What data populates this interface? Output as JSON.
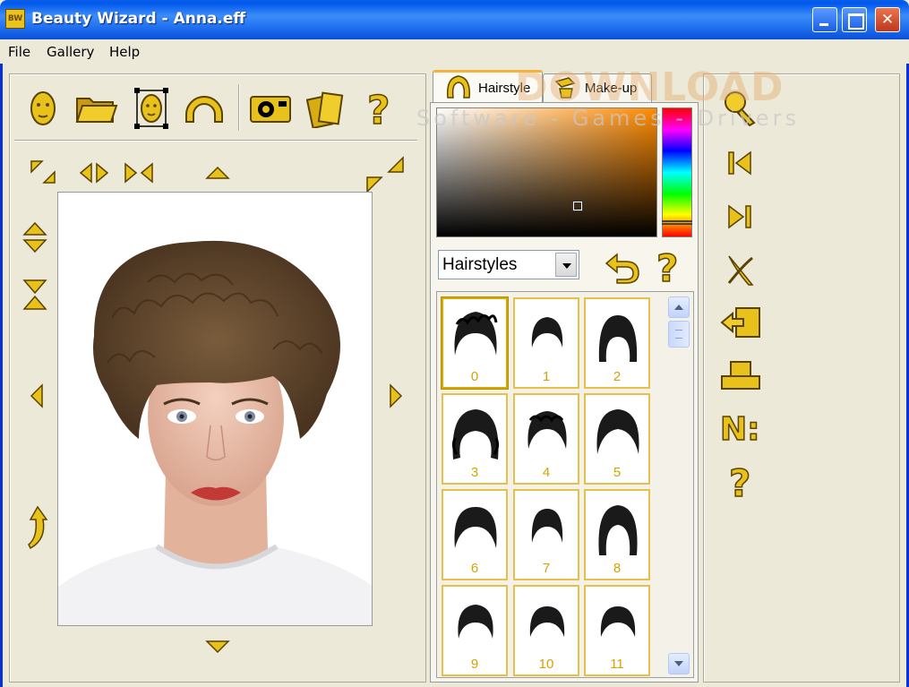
{
  "window": {
    "title": "Beauty Wizard - Anna.eff",
    "app_icon_text": "BW"
  },
  "menu": {
    "file": "File",
    "gallery": "Gallery",
    "help": "Help"
  },
  "toolbar": {
    "icons": [
      "face-icon",
      "open-folder-icon",
      "face-select-icon",
      "arc-icon",
      "camera-icon",
      "cards-icon",
      "help-icon"
    ],
    "help_glyph": "?"
  },
  "tabs": {
    "hairstyle": "Hairstyle",
    "makeup": "Make-up",
    "active": "Hairstyle"
  },
  "color_picker": {
    "base_color": "#ff8a00"
  },
  "category_select": {
    "value": "Hairstyles"
  },
  "gallery": {
    "selected": "0",
    "items": [
      "0",
      "1",
      "2",
      "3",
      "4",
      "5",
      "6",
      "7",
      "8",
      "9",
      "10",
      "11"
    ]
  },
  "right_toolbar": {
    "icons": [
      "zoom-icon",
      "first-icon",
      "last-icon",
      "cut-icon",
      "import-icon",
      "stamp-icon",
      "number-icon",
      "help-icon"
    ],
    "number_glyph": "N:",
    "help_glyph": "?"
  },
  "watermark": {
    "title": "DOWNLOAD",
    "subtitle": "Software - Games - Drivers"
  },
  "colors": {
    "accent_gold": "#e8c21a",
    "icon_outline": "#5a4300",
    "title_bar": "#0a58e6"
  }
}
